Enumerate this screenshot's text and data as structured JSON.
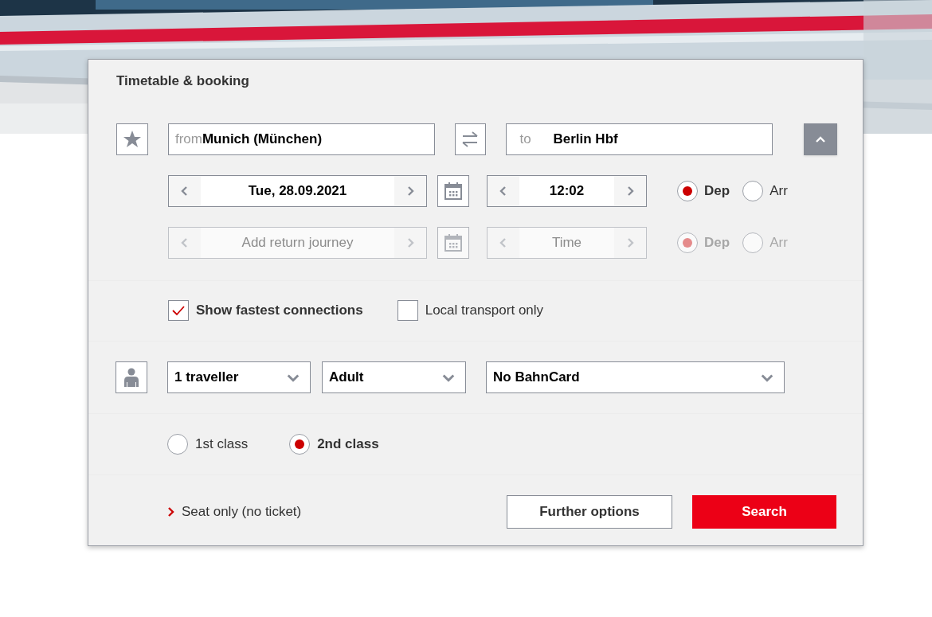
{
  "panel": {
    "title": "Timetable & booking",
    "expanded": true
  },
  "outbound": {
    "from_label": "from",
    "from_value": "Munich (München)",
    "to_label": "to",
    "to_value": "Berlin Hbf",
    "date": "Tue, 28.09.2021",
    "time": "12:02",
    "modes": [
      {
        "label": "Dep",
        "selected": true
      },
      {
        "label": "Arr",
        "selected": false
      }
    ]
  },
  "return": {
    "disabled": true,
    "date_placeholder": "Add return journey",
    "time_placeholder": "Time",
    "modes": [
      {
        "label": "Dep",
        "selected": true
      },
      {
        "label": "Arr",
        "selected": false
      }
    ]
  },
  "options": [
    {
      "label": "Show fastest connections",
      "checked": true
    },
    {
      "label": "Local transport only",
      "checked": false
    }
  ],
  "passengers": {
    "dropdowns": [
      "1 traveller",
      "Adult",
      "No BahnCard"
    ]
  },
  "classes": [
    {
      "label": "1st class",
      "selected": false
    },
    {
      "label": "2nd class",
      "selected": true
    }
  ],
  "seat_link": "Seat only (no ticket)",
  "buttons": [
    {
      "label": "Further options",
      "kind": "secondary"
    },
    {
      "label": "Search",
      "kind": "primary"
    }
  ]
}
